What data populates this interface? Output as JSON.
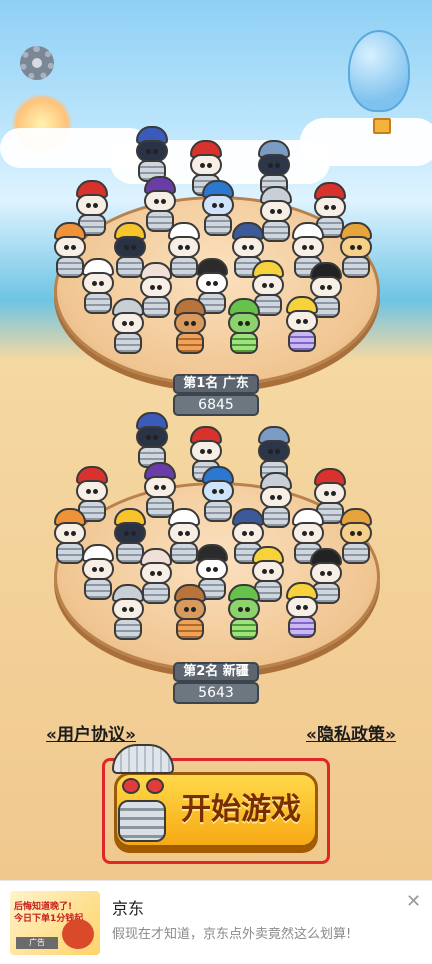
{
  "settings_icon": "gear-icon",
  "rankings": [
    {
      "rank_prefix": "第",
      "rank": "1",
      "rank_suffix": "名",
      "region": "广东",
      "score": "6845"
    },
    {
      "rank_prefix": "第",
      "rank": "2",
      "rank_suffix": "名",
      "region": "新疆",
      "score": "5643"
    }
  ],
  "links": {
    "user_agreement": "«用户协议»",
    "privacy_policy": "«隐私政策»"
  },
  "start_button": {
    "label": "开始游戏"
  },
  "ad": {
    "thumb_line1": "后悔知道晚了!",
    "thumb_line2": "今日下单1分钱起",
    "thumb_tag": "广告",
    "title": "京东",
    "description": "假现在才知道，京东点外卖竟然这么划算!",
    "close_icon": "close-icon"
  },
  "colors": {
    "start_button": "#f7b51e",
    "highlight_frame": "#e02727",
    "rank_box": "#5d6670"
  }
}
